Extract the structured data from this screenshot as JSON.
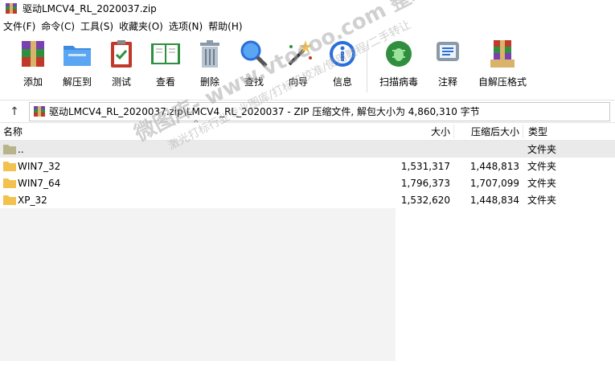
{
  "window": {
    "title": "驱动LMCV4_RL_2020037.zip"
  },
  "menu": [
    "文件(F)",
    "命令(C)",
    "工具(S)",
    "收藏夹(O)",
    "选项(N)",
    "帮助(H)"
  ],
  "toolbar": [
    {
      "label": "添加",
      "icon": "add-archive-icon"
    },
    {
      "label": "解压到",
      "icon": "extract-to-icon"
    },
    {
      "label": "测试",
      "icon": "test-icon"
    },
    {
      "label": "查看",
      "icon": "view-icon"
    },
    {
      "label": "删除",
      "icon": "delete-icon"
    },
    {
      "label": "查找",
      "icon": "find-icon"
    },
    {
      "label": "向导",
      "icon": "wizard-icon"
    },
    {
      "label": "信息",
      "icon": "info-icon"
    },
    {
      "label": "扫描病毒",
      "icon": "virus-scan-icon"
    },
    {
      "label": "注释",
      "icon": "comment-icon"
    },
    {
      "label": "自解压格式",
      "icon": "sfx-icon"
    }
  ],
  "address": {
    "text": "驱动LMCV4_RL_2020037.zip\\LMCV4_RL_2020037 - ZIP 压缩文件, 解包大小为 4,860,310 字节"
  },
  "columns": {
    "name": "名称",
    "size": "大小",
    "packed": "压缩后大小",
    "type": "类型"
  },
  "rows": [
    {
      "name": "..",
      "size": "",
      "packed": "",
      "type": "文件夹"
    },
    {
      "name": "WIN7_32",
      "size": "1,531,317",
      "packed": "1,448,813",
      "type": "文件夹"
    },
    {
      "name": "WIN7_64",
      "size": "1,796,373",
      "packed": "1,707,099",
      "type": "文件夹"
    },
    {
      "name": "XP_32",
      "size": "1,532,620",
      "packed": "1,448,834",
      "type": "文件夹"
    }
  ],
  "watermark": {
    "line1": "微图库- www.vtocoo.com 整理发布",
    "line2": "激光打标行业专业图库/打标机校准/使用教程/二手转让"
  },
  "colors": {
    "folder": "#f2c14e",
    "accent": "#2a6fdb"
  }
}
